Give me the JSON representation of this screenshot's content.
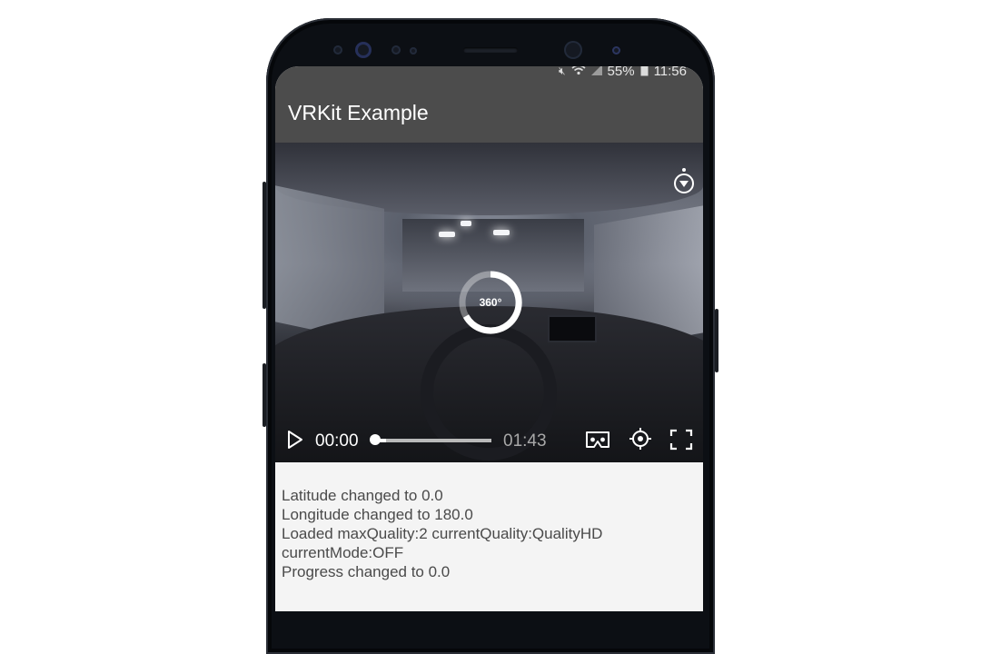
{
  "status_bar": {
    "battery": "55%",
    "time": "11:56",
    "icons": [
      "mute-icon",
      "wifi-icon",
      "signal-icon",
      "battery-icon"
    ]
  },
  "app_bar": {
    "title": "VRKit Example"
  },
  "player": {
    "badge": "360°",
    "current_time": "00:00",
    "duration": "01:43",
    "buffered_fraction": 0.12,
    "played_fraction": 0.0,
    "icons": [
      "compass-icon",
      "play-icon",
      "vr-headset-icon",
      "gyro-icon",
      "fullscreen-icon"
    ]
  },
  "log": {
    "lines": [
      "Latitude changed to 0.0",
      "Longitude changed to 180.0",
      "Loaded maxQuality:2 currentQuality:QualityHD",
      "currentMode:OFF",
      "Progress changed to 0.0"
    ]
  },
  "colors": {
    "app_bar": "#4c4c4c",
    "log_background": "#f4f4f4",
    "log_text": "#4a4a4a"
  }
}
